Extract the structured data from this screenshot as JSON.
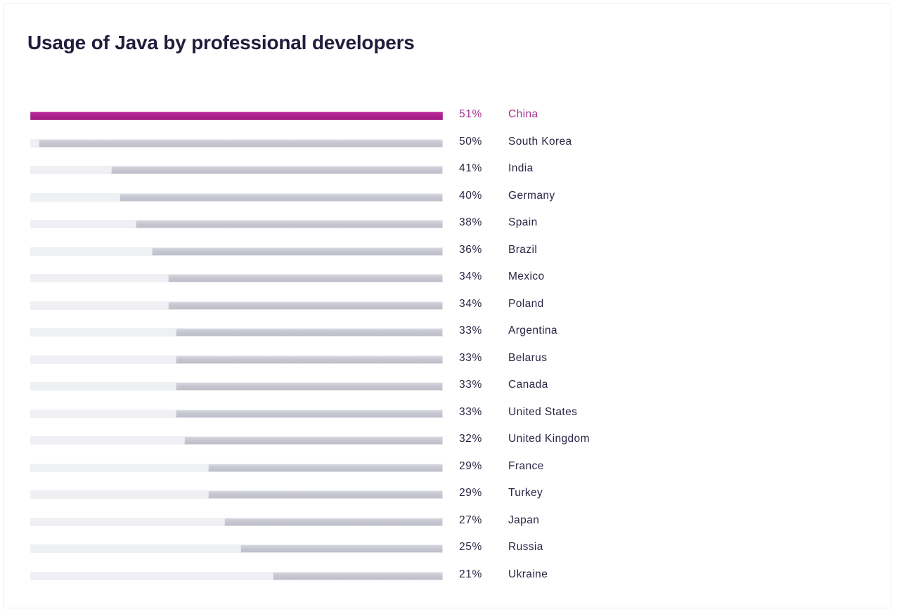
{
  "title": "Usage of Java by professional developers",
  "colors": {
    "highlight": "#ab1f8d",
    "bar": "#c6c7d1",
    "track": "#eff0f4",
    "text": "#2b2545",
    "highlight_text": "#a4308f",
    "background": "#ffffff"
  },
  "chart_data": {
    "type": "bar",
    "orientation": "horizontal",
    "title": "Usage of Java by professional developers",
    "xlabel": "",
    "ylabel": "",
    "xlim": [
      0,
      51
    ],
    "grid": false,
    "legend": false,
    "bar_alignment": "right",
    "value_suffix": "%",
    "highlight_category": "China",
    "categories": [
      "China",
      "South Korea",
      "India",
      "Germany",
      "Spain",
      "Brazil",
      "Mexico",
      "Poland",
      "Argentina",
      "Belarus",
      "Canada",
      "United States",
      "United Kingdom",
      "France",
      "Turkey",
      "Japan",
      "Russia",
      "Ukraine"
    ],
    "values": [
      51,
      50,
      41,
      40,
      38,
      36,
      34,
      34,
      33,
      33,
      33,
      33,
      32,
      29,
      29,
      27,
      25,
      21
    ],
    "value_labels": [
      "51%",
      "50%",
      "41%",
      "40%",
      "38%",
      "36%",
      "34%",
      "34%",
      "33%",
      "33%",
      "33%",
      "33%",
      "32%",
      "29%",
      "29%",
      "27%",
      "25%",
      "21%"
    ]
  }
}
